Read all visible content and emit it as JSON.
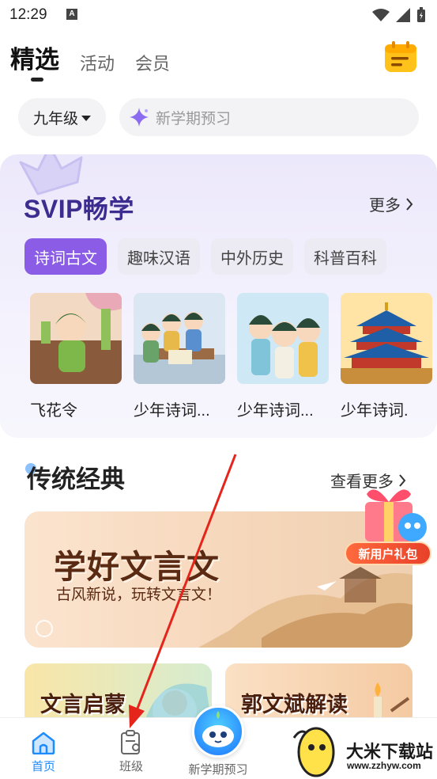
{
  "status_bar": {
    "time": "12:29",
    "notification_icon": "A"
  },
  "top_tabs": [
    {
      "label": "精选",
      "active": true
    },
    {
      "label": "活动",
      "active": false
    },
    {
      "label": "会员",
      "active": false
    }
  ],
  "filters": {
    "grade": "九年级",
    "search_placeholder": "新学期预习"
  },
  "svip": {
    "title": "SVIP畅学",
    "more": "更多",
    "chips": [
      "诗词古文",
      "趣味汉语",
      "中外历史",
      "科普百科"
    ],
    "cards": [
      {
        "name": "飞花令"
      },
      {
        "name": "少年诗词..."
      },
      {
        "name": "少年诗词..."
      },
      {
        "name": "少年诗词."
      }
    ]
  },
  "traditional": {
    "title": "传统经典",
    "more": "查看更多",
    "banner_title": "学好文言文",
    "banner_subtitle": "古风新说，玩转文言文！",
    "cards": [
      "文言启蒙",
      "郭文斌解读"
    ]
  },
  "gift_badge": "新用户礼包",
  "bottom_nav": [
    {
      "label": "首页",
      "active": true
    },
    {
      "label": "班级",
      "active": false
    },
    {
      "label": "新学期预习",
      "active": false
    }
  ],
  "watermark": {
    "title": "大米下载站",
    "url": "www.zzhyw.com"
  },
  "colors": {
    "accent": "#8b5ce6",
    "svip_title": "#3d2c8f",
    "nav_active": "#1e8bff",
    "arrow": "#e5251c"
  }
}
